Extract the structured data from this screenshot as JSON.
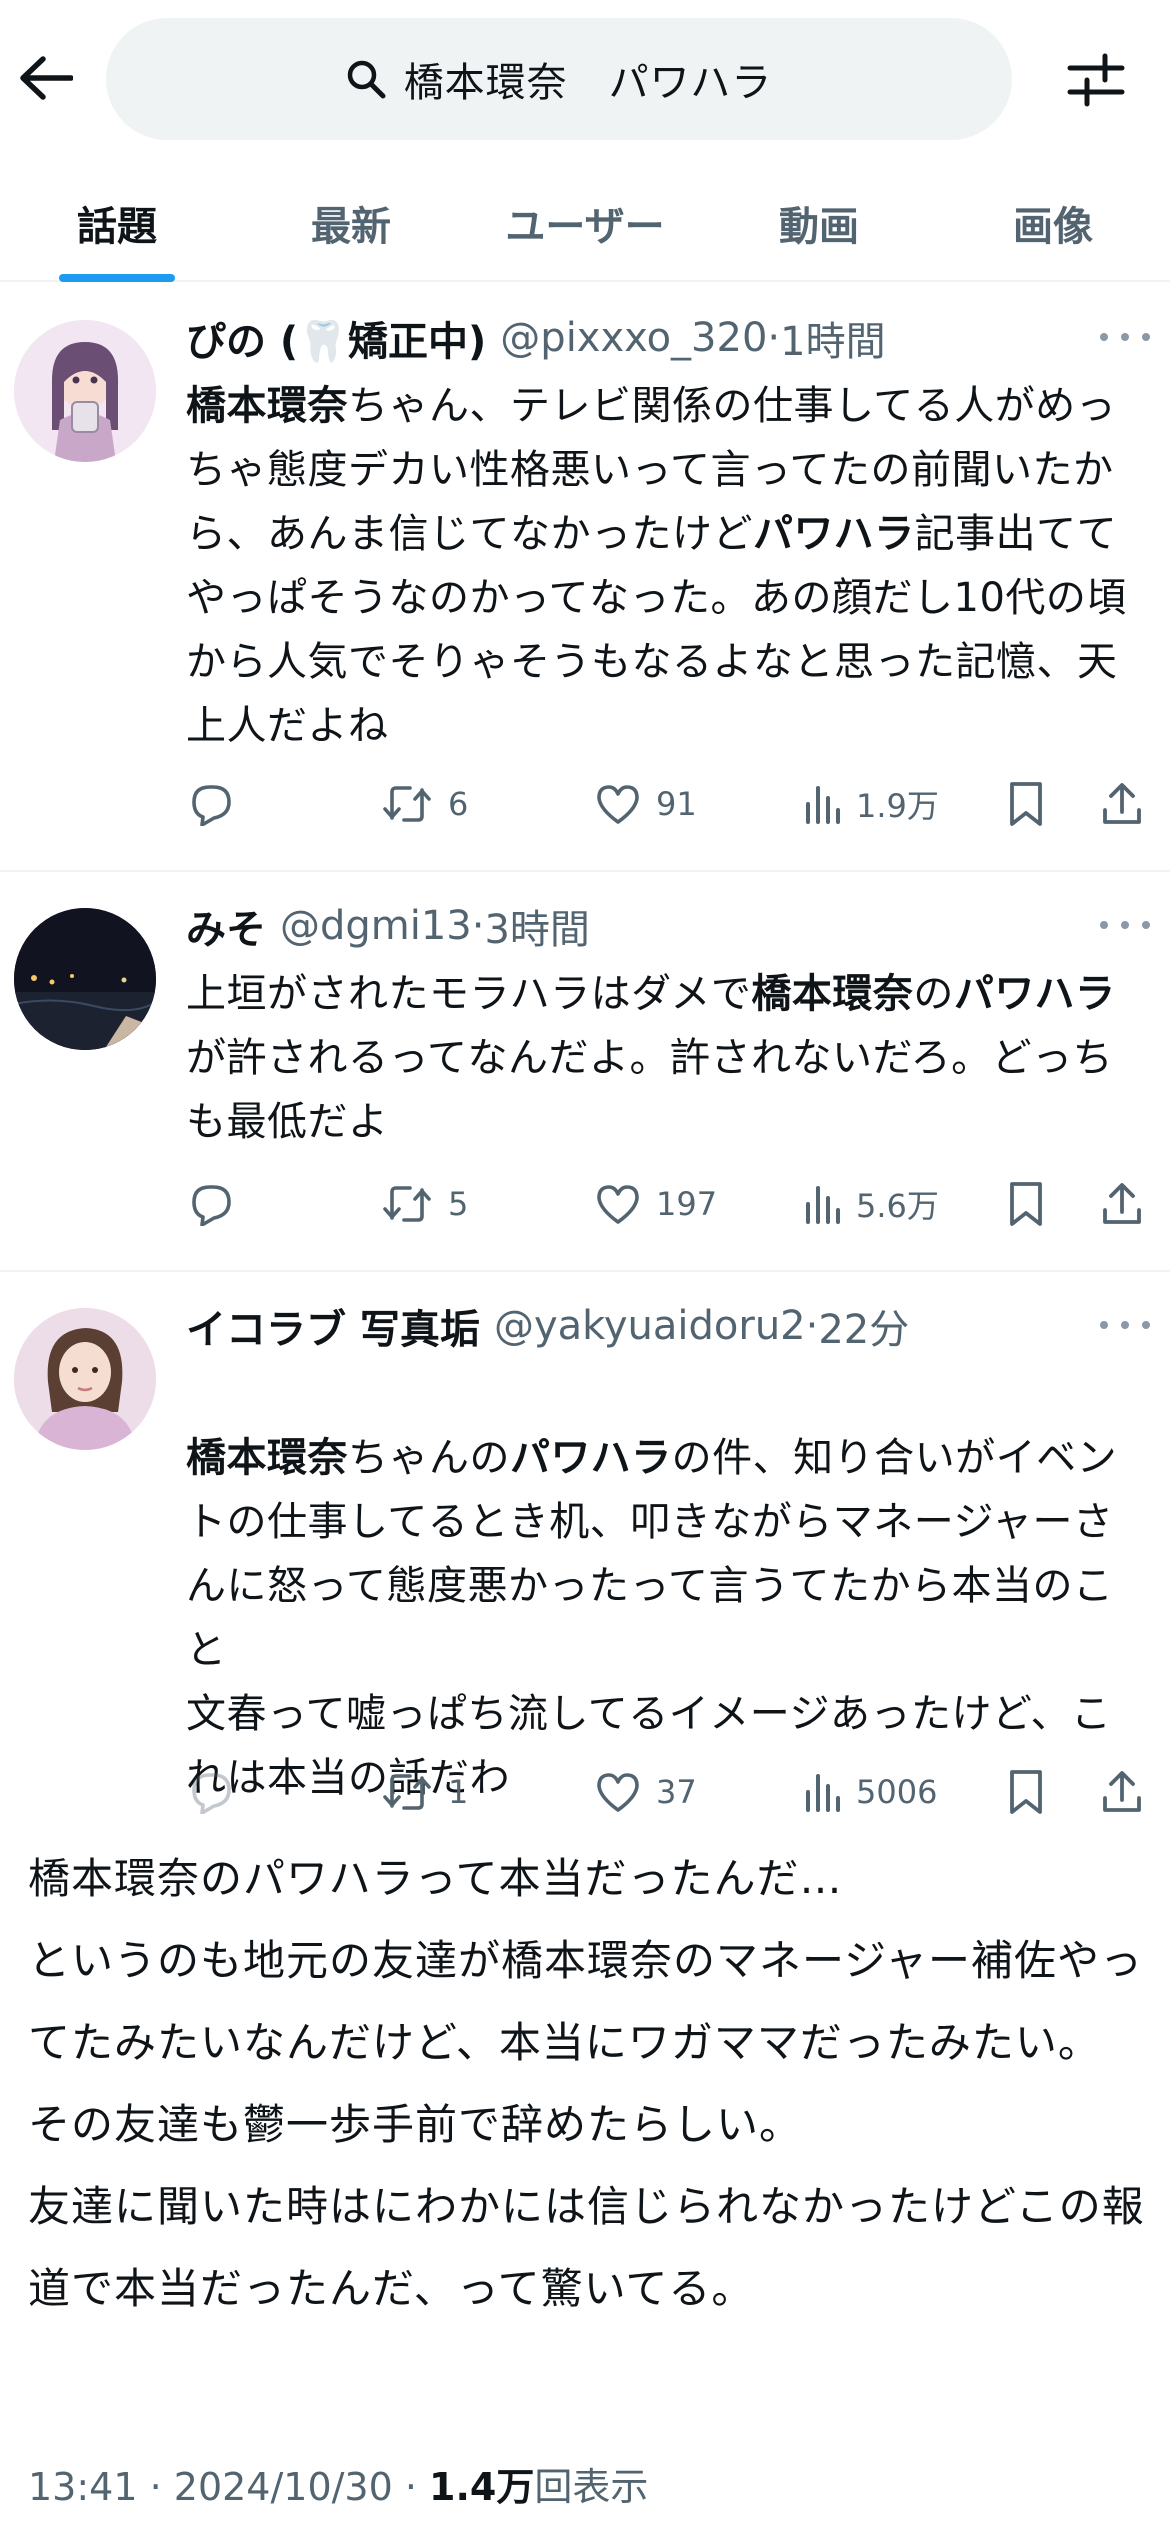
{
  "search": {
    "query": "橋本環奈　パワハラ"
  },
  "tabs": [
    {
      "label": "話題",
      "active": true
    },
    {
      "label": "最新"
    },
    {
      "label": "ユーザー"
    },
    {
      "label": "動画"
    },
    {
      "label": "画像"
    }
  ],
  "tweets": [
    {
      "name": "ぴの (🦷矯正中)",
      "handle": "@pixxxo_320",
      "sep": "·",
      "time": "1時間",
      "text_segments": [
        {
          "t": "橋本環奈",
          "b": true
        },
        {
          "t": "ちゃん、テレビ関係の仕事してる人がめっちゃ態度デカい性格悪いって言ってたの前聞いたから、あんま信じてなかったけど"
        },
        {
          "t": "パワハラ",
          "b": true
        },
        {
          "t": "記事出ててやっぱそうなのかってなった。あの顔だし10代の頃から人気でそりゃそうもなるよなと思った記憶、天上人だよね"
        }
      ],
      "replies": "",
      "retweets": "6",
      "likes": "91",
      "views": "1.9万"
    },
    {
      "name": "みそ",
      "handle": "@dgmi13",
      "sep": "·",
      "time": "3時間",
      "text_segments": [
        {
          "t": "上垣がされたモラハラはダメで"
        },
        {
          "t": "橋本環奈",
          "b": true
        },
        {
          "t": "の"
        },
        {
          "t": "パワハラ",
          "b": true
        },
        {
          "t": "が許されるってなんだよ。許されないだろ。どっちも最低だよ"
        }
      ],
      "replies": "",
      "retweets": "5",
      "likes": "197",
      "views": "5.6万"
    },
    {
      "name": "イコラブ 写真垢",
      "handle": "@yakyuaidoru2",
      "sep": "·",
      "time": "22分",
      "text_segments": [
        {
          "t": "橋本環奈",
          "b": true
        },
        {
          "t": "ちゃんの"
        },
        {
          "t": "パワハラ",
          "b": true
        },
        {
          "t": "の件、知り合いがイベントの仕事してるとき机、叩きながらマネージャーさんに怒って態度悪かったって言うてたから本当のこと\n文春って嘘っぱち流してるイメージあったけど、これは本当の話だわ"
        }
      ],
      "replies": "",
      "retweets": "1",
      "likes": "37",
      "views": "5006"
    }
  ],
  "post": {
    "text": "橋本環奈のパワハラって本当だったんだ…\nというのも地元の友達が橋本環奈のマネージャー補佐やってたみたいなんだけど、本当にワガママだったみたい。\nその友達も鬱一歩手前で辞めたらしい。\n友達に聞いた時はにわかには信じられなかったけどこの報道で本当だったんだ、って驚いてる。",
    "time": "13:41",
    "sep1": " · ",
    "date": "2024/10/30",
    "sep2": " · ",
    "views_count": "1.4万",
    "views_label": "回表示"
  },
  "colors": {
    "accent": "#1d9bf0",
    "muted": "#536471",
    "text": "#0f1419"
  }
}
